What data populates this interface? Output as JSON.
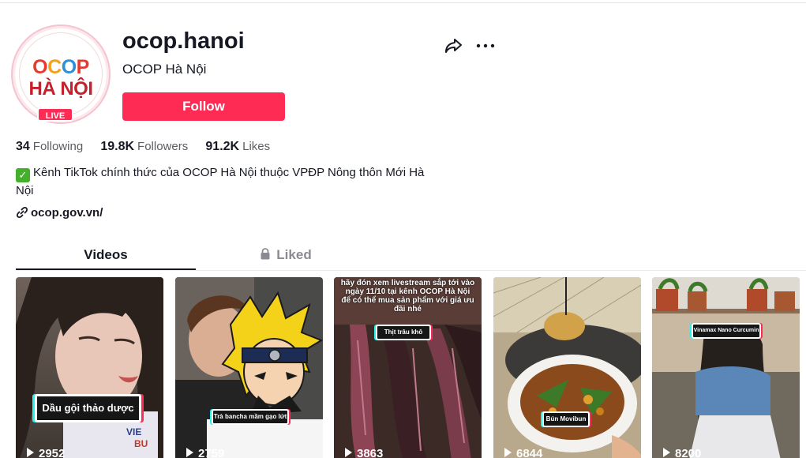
{
  "profile": {
    "username": "ocop.hanoi",
    "display_name": "OCOP Hà Nội",
    "avatar_logo_top": [
      "O",
      "C",
      "O",
      "P"
    ],
    "avatar_logo_bottom": "HÀ NỘI",
    "live_badge": "LIVE",
    "follow_label": "Follow"
  },
  "stats": [
    {
      "value": "34",
      "label": "Following"
    },
    {
      "value": "19.8K",
      "label": "Followers"
    },
    {
      "value": "91.2K",
      "label": "Likes"
    }
  ],
  "bio": {
    "check": "✓",
    "text": "Kênh TikTok chính thức của OCOP Hà Nội thuộc VPĐP Nông thôn Mới Hà Nội"
  },
  "link": {
    "text": "ocop.gov.vn/"
  },
  "tabs": {
    "videos": "Videos",
    "liked": "Liked"
  },
  "videos": [
    {
      "caption": "Dầu gội thảo dược",
      "views": "2952"
    },
    {
      "caption": "Trà bancha mầm gạo lứt",
      "views": "2759"
    },
    {
      "caption": "Thịt trâu khô",
      "views": "3863",
      "overlay": "hãy đón xem livestream sắp tới vào ngày 11/10 tại kênh OCOP Hà Nội để có thể mua sản phẩm với giá ưu đãi nhé"
    },
    {
      "caption": "Bún Movibun",
      "views": "6844"
    },
    {
      "caption": "Vinamax Nano Curcumin",
      "views": "8200"
    }
  ],
  "colors": {
    "brand": "#fe2c55",
    "text": "#161823",
    "muted": "#8a8b91"
  }
}
